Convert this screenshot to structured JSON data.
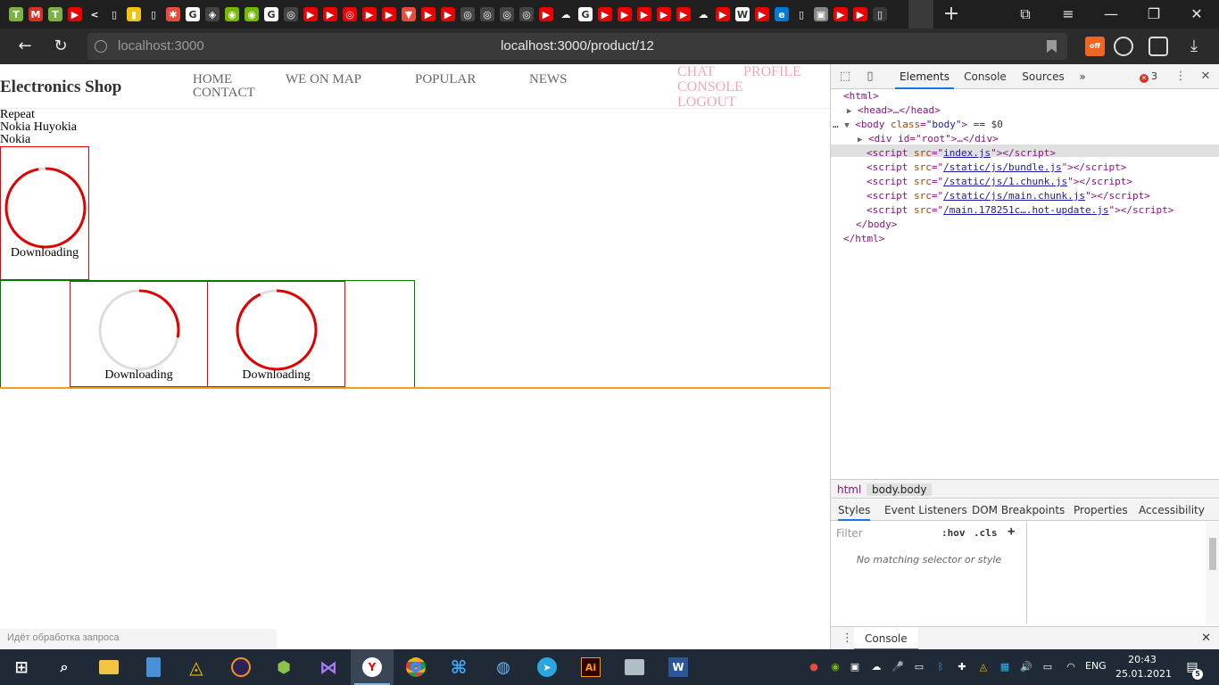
{
  "browser": {
    "tab_icons": [
      {
        "name": "yellow-t-icon",
        "color": "#7cb342",
        "glyph": "T"
      },
      {
        "name": "gmail-icon",
        "color": "#d93025",
        "glyph": "M"
      },
      {
        "name": "yellow-t-icon",
        "color": "#7cb342",
        "glyph": "T"
      },
      {
        "name": "youtube-icon",
        "color": "#e00",
        "glyph": "▶"
      },
      {
        "name": "back-arrow-icon",
        "color": "#1f1f1f",
        "glyph": "<"
      },
      {
        "name": "file-icon",
        "color": "#1f1f1f",
        "glyph": "▯"
      },
      {
        "name": "bookmark-icon",
        "color": "#f1c40f",
        "glyph": "▮"
      },
      {
        "name": "file-icon",
        "color": "#1f1f1f",
        "glyph": "▯"
      },
      {
        "name": "asterisk-icon",
        "color": "#e74c3c",
        "glyph": "✱"
      },
      {
        "name": "google-icon",
        "color": "#ffffff",
        "glyph": "G"
      },
      {
        "name": "codepen-icon",
        "color": "#444",
        "glyph": "◈"
      },
      {
        "name": "nvidia-icon",
        "color": "#76b900",
        "glyph": "◉"
      },
      {
        "name": "nvidia-icon",
        "color": "#76b900",
        "glyph": "◉"
      },
      {
        "name": "google-icon",
        "color": "#ffffff",
        "glyph": "G"
      },
      {
        "name": "github-icon",
        "color": "#444",
        "glyph": "◎"
      },
      {
        "name": "youtube-icon",
        "color": "#e00",
        "glyph": "▶"
      },
      {
        "name": "youtube-icon",
        "color": "#e00",
        "glyph": "▶"
      },
      {
        "name": "target-icon",
        "color": "#e00",
        "glyph": "◎"
      },
      {
        "name": "youtube-icon",
        "color": "#e00",
        "glyph": "▶"
      },
      {
        "name": "youtube-icon",
        "color": "#e00",
        "glyph": "▶"
      },
      {
        "name": "pdf-icon",
        "color": "#e74c3c",
        "glyph": "▼"
      },
      {
        "name": "youtube-icon",
        "color": "#e00",
        "glyph": "▶"
      },
      {
        "name": "youtube-icon",
        "color": "#e00",
        "glyph": "▶"
      },
      {
        "name": "github-icon",
        "color": "#444",
        "glyph": "◎"
      },
      {
        "name": "github-icon",
        "color": "#444",
        "glyph": "◎"
      },
      {
        "name": "github-icon",
        "color": "#444",
        "glyph": "◎"
      },
      {
        "name": "github-icon",
        "color": "#444",
        "glyph": "◎"
      },
      {
        "name": "youtube-icon",
        "color": "#e00",
        "glyph": "▶"
      },
      {
        "name": "cloud-icon",
        "color": "#1f1f1f",
        "glyph": "☁"
      },
      {
        "name": "google-icon",
        "color": "#ffffff",
        "glyph": "G"
      },
      {
        "name": "youtube-icon",
        "color": "#e00",
        "glyph": "▶"
      },
      {
        "name": "youtube-icon",
        "color": "#e00",
        "glyph": "▶"
      },
      {
        "name": "youtube-icon",
        "color": "#e00",
        "glyph": "▶"
      },
      {
        "name": "youtube-icon",
        "color": "#e00",
        "glyph": "▶"
      },
      {
        "name": "youtube-icon",
        "color": "#e00",
        "glyph": "▶"
      },
      {
        "name": "cloud-icon",
        "color": "#1f1f1f",
        "glyph": "☁"
      },
      {
        "name": "youtube-icon",
        "color": "#e00",
        "glyph": "▶"
      },
      {
        "name": "wikipedia-icon",
        "color": "#ffffff",
        "glyph": "W"
      },
      {
        "name": "youtube-icon",
        "color": "#e00",
        "glyph": "▶"
      },
      {
        "name": "edge-icon",
        "color": "#0078d7",
        "glyph": "e"
      },
      {
        "name": "file-icon",
        "color": "#1f1f1f",
        "glyph": "▯"
      },
      {
        "name": "photo-icon",
        "color": "#888",
        "glyph": "▣"
      },
      {
        "name": "youtube-icon",
        "color": "#e00",
        "glyph": "▶"
      },
      {
        "name": "youtube-icon",
        "color": "#e00",
        "glyph": "▶"
      },
      {
        "name": "file-icon",
        "color": "#3a3a3a",
        "glyph": "▯"
      }
    ],
    "host_hint": "localhost:3000",
    "url": "localhost:3000/product/12",
    "status_text": "Идёт обработка запроса"
  },
  "page": {
    "brand": "Electronics Shop",
    "nav": {
      "home": "HOME",
      "contact": "CONTACT",
      "we_on_map": "WE ON MAP",
      "popular": "POPULAR",
      "news": "NEWS",
      "chat": "CHAT",
      "profile": "PROFILE",
      "console": "CONSOLE",
      "logout": "LOGOUT"
    },
    "lines": [
      "Repeat",
      "Nokia Huyokia",
      "Nokia"
    ],
    "downloads": [
      {
        "label": "Downloading",
        "progress": 0.97
      },
      {
        "label": "Downloading",
        "progress": 0.28
      },
      {
        "label": "Downloading",
        "progress": 0.93
      }
    ],
    "colors": {
      "spinner_active": "#e00000",
      "spinner_track": "#dddddd",
      "orange_rule": "#f0a020"
    }
  },
  "devtools": {
    "tabs": [
      "Elements",
      "Console",
      "Sources"
    ],
    "more": "»",
    "error_count": "3",
    "dom": {
      "html_open": "<html>",
      "head": "<head>…</head>",
      "body_open_tag": "body",
      "body_class_attr": "class",
      "body_class_val": "\"body\"",
      "body_eq": "== $0",
      "div_root": "<div id=\"root\">…</div>",
      "scripts": [
        "index.js",
        "/static/js/bundle.js",
        "/static/js/1.chunk.js",
        "/static/js/main.chunk.js",
        "/main.178251c….hot-update.js"
      ],
      "body_close": "</body>",
      "html_close": "</html>"
    },
    "crumbs": [
      "html",
      "body.body"
    ],
    "subtabs": [
      "Styles",
      "Event Listeners",
      "DOM Breakpoints",
      "Properties",
      "Accessibility"
    ],
    "filter_placeholder": "Filter",
    "hov": ":hov",
    "cls": ".cls",
    "plus": "+",
    "no_match": "No matching selector or style",
    "drawer_tab": "Console"
  },
  "taskbar": {
    "lang": "ENG",
    "time": "20:43",
    "date": "25.01.2021",
    "notifications": "5"
  }
}
